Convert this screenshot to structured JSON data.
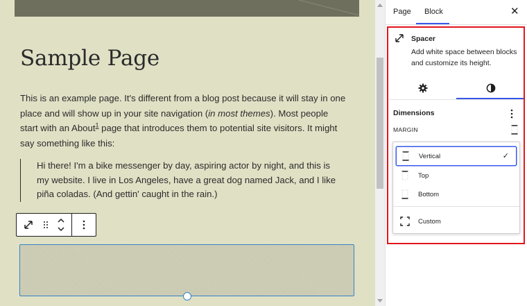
{
  "editor": {
    "page_title": "Sample Page",
    "paragraph": {
      "part1": "This is an example page. It's different from a blog post because it will stay in one place and will show up in your site navigation (",
      "em": "in most themes",
      "part2": "). Most people start with an About",
      "footnote": "1",
      "part3": " page that introduces them to potential site visitors. It might say something like this:"
    },
    "quote": "Hi there! I'm a bike messenger by day, aspiring actor by night, and this is my website. I live in Los Angeles, have a great dog named Jack, and I like piña coladas. (And gettin' caught in the rain.)",
    "toolbar_icons": [
      "resize-icon",
      "drag-handle-icon",
      "move-up-down-icon",
      "more-options-icon"
    ]
  },
  "sidebar": {
    "tabs": [
      {
        "label": "Page",
        "active": false
      },
      {
        "label": "Block",
        "active": true
      }
    ],
    "close_label": "✕",
    "block": {
      "name": "Spacer",
      "description": "Add white space between blocks and customize its height."
    },
    "sub_tabs": [
      "settings-gear-icon",
      "styles-contrast-icon"
    ],
    "dimensions": {
      "title": "Dimensions",
      "margin_label": "MARGIN",
      "options": [
        {
          "label": "Vertical",
          "selected": true
        },
        {
          "label": "Top",
          "selected": false
        },
        {
          "label": "Bottom",
          "selected": false
        },
        {
          "label": "Custom",
          "selected": false
        }
      ],
      "check_mark": "✓"
    }
  },
  "colors": {
    "canvas_bg": "#e0e0c5",
    "accent": "#3858e9",
    "block_outline": "#3582c4",
    "highlight_box": "#e3141d"
  }
}
